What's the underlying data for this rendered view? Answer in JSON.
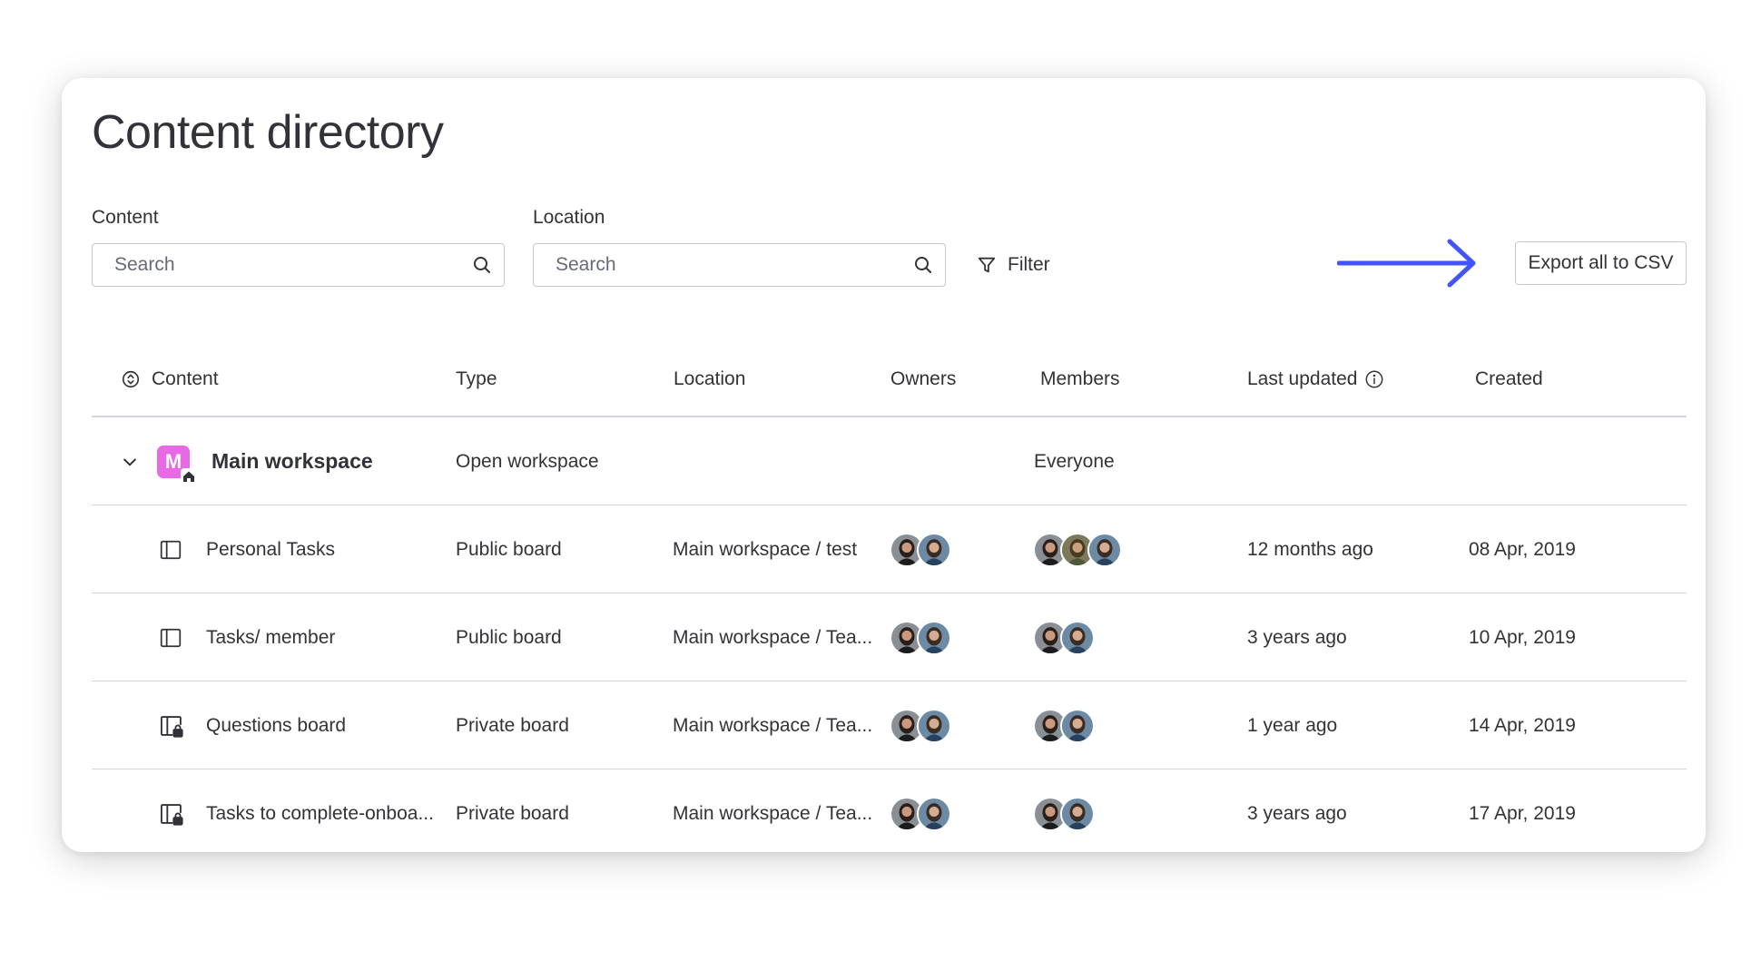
{
  "page": {
    "title": "Content directory"
  },
  "filters": {
    "content": {
      "label": "Content",
      "placeholder": "Search"
    },
    "location": {
      "label": "Location",
      "placeholder": "Search"
    },
    "filter_label": "Filter",
    "export_label": "Export all to CSV"
  },
  "colors": {
    "accent_arrow": "#4353ff",
    "workspace_badge": "#e869e4",
    "divider": "#d0d4e4"
  },
  "table": {
    "headers": {
      "content": "Content",
      "type": "Type",
      "location": "Location",
      "owners": "Owners",
      "members": "Members",
      "last_updated": "Last updated",
      "created": "Created"
    },
    "workspace": {
      "initial": "M",
      "name": "Main workspace",
      "type": "Open workspace",
      "members": "Everyone"
    },
    "rows": [
      {
        "name": "Personal Tasks",
        "icon": "board-icon",
        "type": "Public board",
        "location": "Main workspace / test",
        "owners": 2,
        "members": 3,
        "last_updated": "12 months ago",
        "created": "08 Apr, 2019"
      },
      {
        "name": "Tasks/ member",
        "icon": "board-icon",
        "type": "Public board",
        "location": "Main workspace / Tea...",
        "owners": 2,
        "members": 2,
        "last_updated": "3 years ago",
        "created": "10 Apr, 2019"
      },
      {
        "name": "Questions board",
        "icon": "private-board-icon",
        "type": "Private board",
        "location": "Main workspace / Tea...",
        "owners": 2,
        "members": 2,
        "last_updated": "1 year ago",
        "created": "14 Apr, 2019"
      },
      {
        "name": "Tasks to complete-onboa...",
        "icon": "private-board-icon",
        "type": "Private board",
        "location": "Main workspace / Tea...",
        "owners": 2,
        "members": 2,
        "last_updated": "3 years ago",
        "created": "17 Apr, 2019"
      }
    ]
  }
}
